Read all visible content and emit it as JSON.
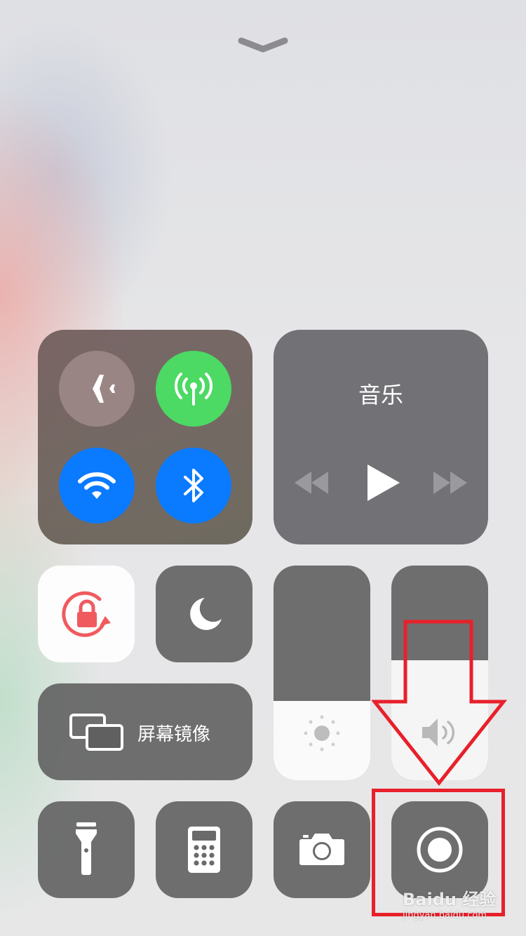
{
  "control_center": {
    "dismiss": {
      "icon": "chevron-down-icon"
    },
    "connectivity": {
      "airplane": {
        "icon": "airplane-icon",
        "enabled": false
      },
      "cellular": {
        "icon": "cellular-antenna-icon",
        "enabled": true,
        "color": "#4cd964"
      },
      "wifi": {
        "icon": "wifi-icon",
        "enabled": true,
        "color": "#0a7aff"
      },
      "bluetooth": {
        "icon": "bluetooth-icon",
        "enabled": true,
        "color": "#0a7aff"
      }
    },
    "music": {
      "title": "音乐",
      "controls": [
        "rewind-icon",
        "play-icon",
        "fast-forward-icon"
      ]
    },
    "orientation_lock": {
      "icon": "rotation-lock-icon",
      "enabled": true,
      "color": "#f05a5f"
    },
    "do_not_disturb": {
      "icon": "moon-icon",
      "enabled": false
    },
    "screen_mirroring": {
      "label": "屏幕镜像",
      "icon": "screen-mirroring-icon"
    },
    "brightness": {
      "icon": "sun-icon",
      "level": 0.37
    },
    "volume": {
      "icon": "speaker-icon",
      "level": 0.56
    },
    "shortcuts": [
      {
        "name": "flashlight",
        "icon": "flashlight-icon"
      },
      {
        "name": "calculator",
        "icon": "calculator-icon"
      },
      {
        "name": "camera",
        "icon": "camera-icon"
      },
      {
        "name": "screen-recording",
        "icon": "record-icon"
      }
    ],
    "annotation": {
      "color": "#e8202a"
    },
    "watermark": {
      "text": "Baidu 经验",
      "subtext": "jingyan.baidu.com"
    }
  }
}
